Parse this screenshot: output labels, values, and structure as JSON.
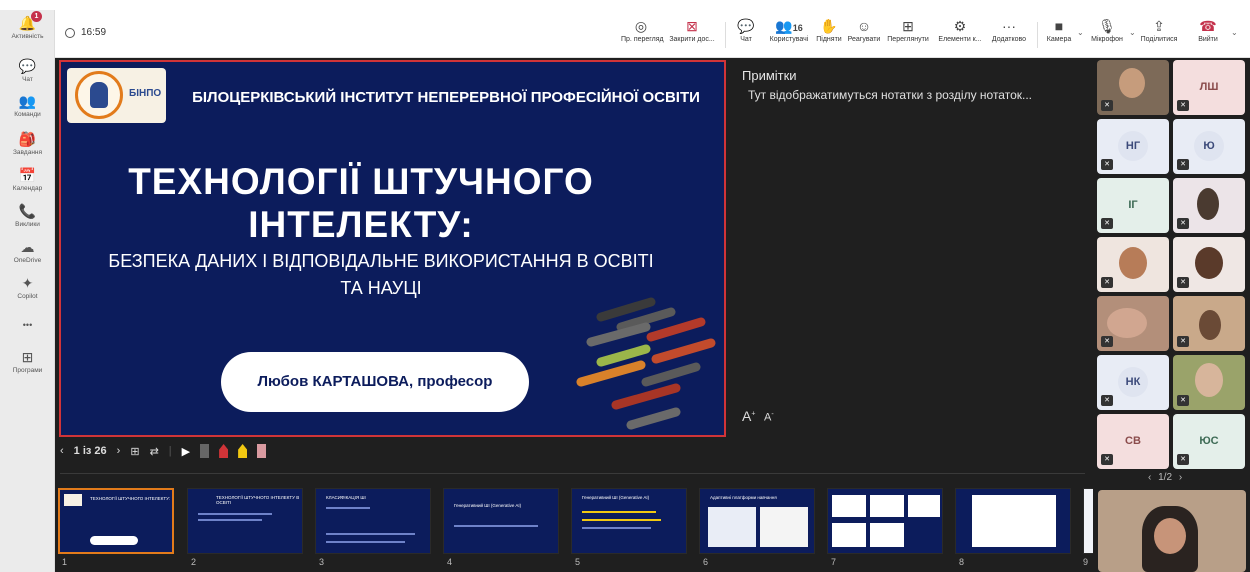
{
  "rail": {
    "items": [
      {
        "label": "Активність",
        "icon": "bell-icon",
        "glyph": "🔔",
        "badge": "1"
      },
      {
        "label": "Чат",
        "icon": "chat-icon",
        "glyph": "💬"
      },
      {
        "label": "Команди",
        "icon": "teams-icon",
        "glyph": "👥"
      },
      {
        "label": "Завдання",
        "icon": "assignments-icon",
        "glyph": "🎒"
      },
      {
        "label": "Календар",
        "icon": "calendar-icon",
        "glyph": "📅"
      },
      {
        "label": "Виклики",
        "icon": "phone-icon",
        "glyph": "📞"
      },
      {
        "label": "OneDrive",
        "icon": "onedrive-icon",
        "glyph": "☁"
      },
      {
        "label": "Copilot",
        "icon": "copilot-icon",
        "glyph": "✦"
      },
      {
        "label": "",
        "icon": "more-icon",
        "glyph": "•••"
      },
      {
        "label": "Програми",
        "icon": "apps-icon",
        "glyph": "⊞"
      }
    ]
  },
  "toolbar": {
    "timer": "16:59",
    "view_label": "Пр. перегляд",
    "close_label": "Закрити дос...",
    "chat_label": "Чат",
    "people_label": "Користувачі",
    "people_count": "16",
    "raise_label": "Підняти",
    "react_label": "Реагувати",
    "view2_label": "Переглянути",
    "elements_label": "Елементи к...",
    "more_label": "Додатково",
    "camera_label": "Камера",
    "mic_label": "Мікрофон",
    "share_label": "Поділитися",
    "leave_label": "Вийти"
  },
  "slide": {
    "logo_text": "БІНПО",
    "institute": "БІЛОЦЕРКІВСЬКИЙ ІНСТИТУТ НЕПЕРЕРВНОЇ ПРОФЕСІЙНОЇ ОСВІТИ",
    "title_line1": "ТЕХНОЛОГІЇ ШТУЧНОГО",
    "title_line2": "ІНТЕЛЕКТУ:",
    "subtitle": "БЕЗПЕКА ДАНИХ І ВІДПОВІДАЛЬНЕ ВИКОРИСТАННЯ В ОСВІТІ ТА НАУЦІ",
    "author": "Любов КАРТАШОВА, професор"
  },
  "notes": {
    "title": "Примітки",
    "body": "Тут відображатимуться нотатки з розділу нотаток..."
  },
  "controls": {
    "page": "1 із 26"
  },
  "thumbnails": [
    {
      "num": "1",
      "head": "ТЕХНОЛОГІЇ ШТУЧНОГО ІНТЕЛЕКТУ:"
    },
    {
      "num": "2",
      "head": "ТЕХНОЛОГІЇ ШТУЧНОГО ІНТЕЛЕКТУ В ОСВІТІ"
    },
    {
      "num": "3",
      "head": "КЛАСИФІКАЦІЯ ШІ"
    },
    {
      "num": "4",
      "head": "Генеративний ШІ (Generative AI)"
    },
    {
      "num": "5",
      "head": "Генеративний ШІ (Generative AI)"
    },
    {
      "num": "6",
      "head": "Адаптивні платформи навчання"
    },
    {
      "num": "7",
      "head": ""
    },
    {
      "num": "8",
      "head": ""
    },
    {
      "num": "9",
      "head": ""
    }
  ],
  "participants": {
    "pager": "1/2",
    "tiles": [
      {
        "initials": "",
        "photo": true
      },
      {
        "initials": "ЛШ",
        "photo": false
      },
      {
        "initials": "НГ",
        "photo": false
      },
      {
        "initials": "Ю",
        "photo": false
      },
      {
        "initials": "ІГ",
        "photo": false
      },
      {
        "initials": "",
        "photo": true
      },
      {
        "initials": "",
        "photo": true
      },
      {
        "initials": "",
        "photo": true
      },
      {
        "initials": "",
        "photo": true
      },
      {
        "initials": "",
        "photo": true
      },
      {
        "initials": "НК",
        "photo": false
      },
      {
        "initials": "",
        "photo": true
      },
      {
        "initials": "СВ",
        "photo": false
      },
      {
        "initials": "ЮС",
        "photo": false
      }
    ]
  },
  "colors": {
    "slide_bg": "#0c1c5c",
    "slide_border": "#d13438",
    "accent_orange": "#e27b1b",
    "leave_red": "#c4314b"
  }
}
